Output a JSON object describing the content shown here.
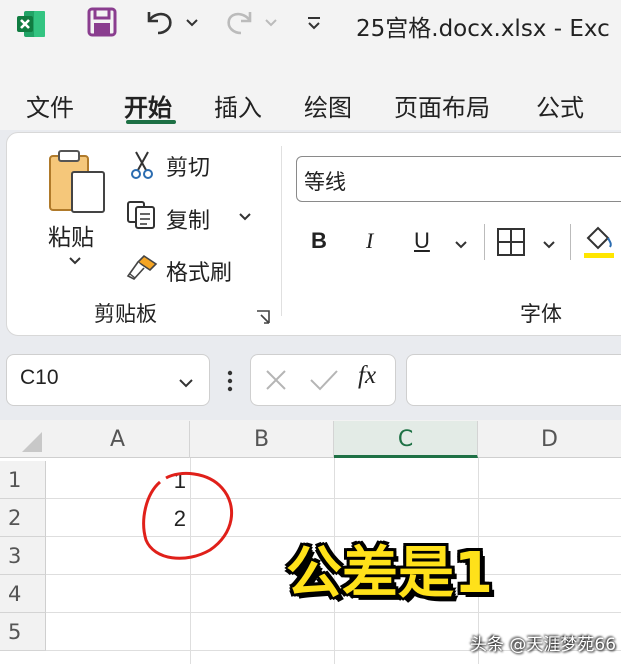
{
  "titlebar": {
    "document_title": "25宫格.docx.xlsx  -  Exc"
  },
  "menu": {
    "tabs": [
      {
        "label": "文件"
      },
      {
        "label": "开始",
        "active": true
      },
      {
        "label": "插入"
      },
      {
        "label": "绘图"
      },
      {
        "label": "页面布局"
      },
      {
        "label": "公式"
      }
    ]
  },
  "ribbon": {
    "clipboard": {
      "paste_label": "粘贴",
      "cut_label": "剪切",
      "copy_label": "复制",
      "format_painter_label": "格式刷",
      "group_label": "剪贴板"
    },
    "font": {
      "font_name": "等线",
      "bold_label": "B",
      "italic_label": "I",
      "underline_label": "U",
      "group_label": "字体"
    }
  },
  "formula_bar": {
    "name_box": "C10",
    "fx_label": "fx",
    "formula_value": ""
  },
  "sheet": {
    "columns": [
      "A",
      "B",
      "C",
      "D"
    ],
    "active_column": "C",
    "rows": [
      "1",
      "2",
      "3",
      "4",
      "5"
    ],
    "cells": {
      "A1": "1",
      "A2": "2"
    }
  },
  "overlay": {
    "caption": "公差是1",
    "watermark": "头条 @天涯梦苑66"
  },
  "colors": {
    "excel_green": "#1e7145",
    "save_purple": "#8a3d8f",
    "annotation_red": "#e0201a",
    "caption_yellow": "#ffe11a",
    "fill_yellow": "#ffe600"
  }
}
